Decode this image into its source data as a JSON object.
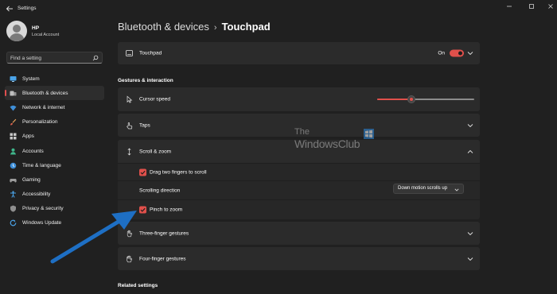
{
  "window": {
    "title": "Settings"
  },
  "profile": {
    "name": "HP",
    "account_type": "Local Account"
  },
  "search": {
    "placeholder": "Find a setting"
  },
  "sidebar": {
    "items": [
      {
        "label": "System",
        "icon": "monitor-icon",
        "active": false
      },
      {
        "label": "Bluetooth & devices",
        "icon": "bluetooth-icon",
        "active": true
      },
      {
        "label": "Network & internet",
        "icon": "wifi-icon",
        "active": false
      },
      {
        "label": "Personalization",
        "icon": "brush-icon",
        "active": false
      },
      {
        "label": "Apps",
        "icon": "apps-icon",
        "active": false
      },
      {
        "label": "Accounts",
        "icon": "person-icon",
        "active": false
      },
      {
        "label": "Time & language",
        "icon": "globe-clock-icon",
        "active": false
      },
      {
        "label": "Gaming",
        "icon": "gamepad-icon",
        "active": false
      },
      {
        "label": "Accessibility",
        "icon": "accessibility-icon",
        "active": false
      },
      {
        "label": "Privacy & security",
        "icon": "shield-icon",
        "active": false
      },
      {
        "label": "Windows Update",
        "icon": "update-icon",
        "active": false
      }
    ]
  },
  "breadcrumb": {
    "parent": "Bluetooth & devices",
    "separator": "›",
    "current": "Touchpad"
  },
  "touchpad": {
    "label": "Touchpad",
    "state": "On"
  },
  "gestures_section": {
    "title": "Gestures & interaction"
  },
  "cursor_speed": {
    "label": "Cursor speed",
    "value_fraction": 0.35
  },
  "taps": {
    "label": "Taps"
  },
  "scroll_zoom": {
    "label": "Scroll & zoom",
    "drag_two_fingers": {
      "label": "Drag two fingers to scroll",
      "checked": true
    },
    "scrolling_direction": {
      "label": "Scrolling direction",
      "value": "Down motion scrolls up"
    },
    "pinch_to_zoom": {
      "label": "Pinch to zoom",
      "checked": true
    }
  },
  "three_finger": {
    "label": "Three-finger gestures"
  },
  "four_finger": {
    "label": "Four-finger gestures"
  },
  "related_settings": {
    "title": "Related settings"
  },
  "watermark": {
    "line1": "The",
    "line2": "WindowsClub"
  },
  "colors": {
    "accent": "#e0504b",
    "background": "#202020",
    "card": "#2b2b2b",
    "arrow": "#1e6fc4"
  }
}
